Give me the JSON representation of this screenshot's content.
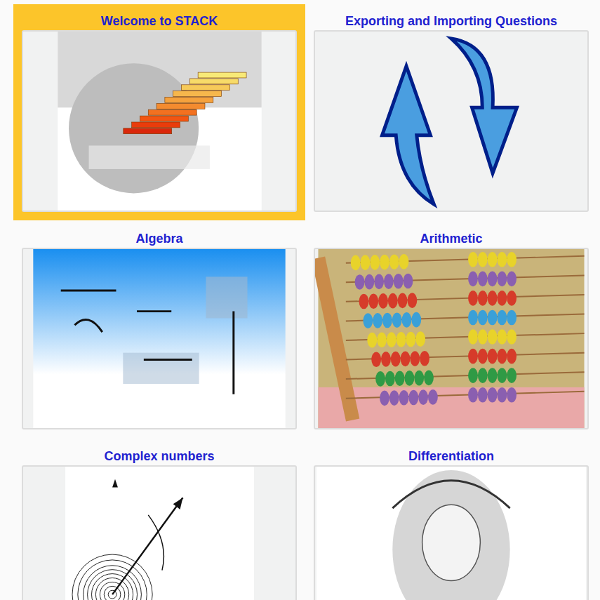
{
  "cards": [
    {
      "title": "Welcome to STACK",
      "selected": true,
      "kind": "logo"
    },
    {
      "title": "Exporting and Importing Questions",
      "selected": false,
      "kind": "arrows"
    },
    {
      "title": "Algebra",
      "selected": false,
      "kind": "formulas"
    },
    {
      "title": "Arithmetic",
      "selected": false,
      "kind": "abacus"
    },
    {
      "title": "Complex numbers",
      "selected": false,
      "kind": "argand"
    },
    {
      "title": "Differentiation",
      "selected": false,
      "kind": "portrait"
    }
  ]
}
